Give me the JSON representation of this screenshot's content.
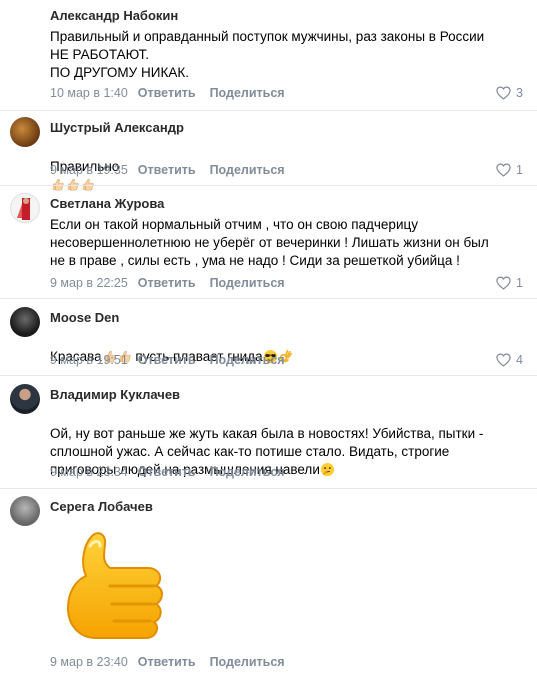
{
  "comments": [
    {
      "author": "Александр Набокин",
      "text": "Правильный и оправданный поступок мужчины, раз законы в России\nНЕ РАБОТАЮТ.\nПО ДРУГОМУ НИКАК.",
      "date": "10 мар в 1:40",
      "reply": "Ответить",
      "share": "Поделиться",
      "likes": "3",
      "avatar": "avatar-blank"
    },
    {
      "author": "Шустрый Александр",
      "text": "Правильно",
      "emoji": [
        "thumbs-up-icon",
        "thumbs-up-icon",
        "thumbs-up-icon"
      ],
      "date": "9 мар в 19:35",
      "reply": "Ответить",
      "share": "Поделиться",
      "likes": "1",
      "avatar": "avatar-cat"
    },
    {
      "author": "Светлана Журова",
      "text": "Если он такой нормальный отчим , что он свою падчерицу\nнесовершеннолетнюю не уберёг от вечеринки ! Лишать жизни он был\nне в праве , силы есть , ума не надо ! Сиди за решеткой убийца !",
      "date": "9 мар в 22:25",
      "reply": "Ответить",
      "share": "Поделиться",
      "likes": "1",
      "avatar": "avatar-red"
    },
    {
      "author": "Moose Den",
      "text_before": "Красава",
      "text_after": " пусть плавает гнида",
      "emoji": [
        "thumbs-up-icon",
        "thumbs-up-icon"
      ],
      "emoji_after": [
        "sunglasses-face-icon",
        "ok-hand-icon"
      ],
      "date": "9 мар в 19:51",
      "reply": "Ответить",
      "share": "Поделиться",
      "likes": "4",
      "avatar": "avatar-dark"
    },
    {
      "author": "Владимир Куклачев",
      "text": "Ой, ну вот раньше же жуть какая была в новостях! Убийства, пытки -\nсплошной ужас. А сейчас как-то потише стало. Видать, строгие\nприговоры людей на размышления навели",
      "emoji": [
        "thinking-face-icon"
      ],
      "date": "9 мар в 23:34",
      "reply": "Ответить",
      "share": "Поделиться",
      "likes": "",
      "avatar": "avatar-man"
    },
    {
      "author": "Серега Лобачев",
      "sticker": "thumbs-up-sticker-icon",
      "date": "9 мар в 23:40",
      "reply": "Ответить",
      "share": "Поделиться",
      "likes": "",
      "avatar": "avatar-grey"
    }
  ],
  "colors": {
    "meta": "#818c99",
    "separator": "#e7e8ec",
    "author": "#2a2a2a"
  }
}
